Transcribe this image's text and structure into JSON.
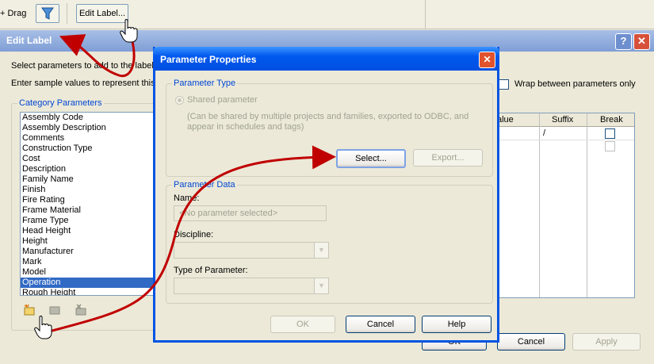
{
  "toolbar": {
    "drag_label": "+ Drag",
    "edit_label_button": "Edit Label..."
  },
  "edit_label": {
    "title": "Edit Label",
    "help_btn": "?",
    "close_btn": "✕",
    "instruction1": "Select parameters to add to the label",
    "instruction2": "Enter sample values to represent this",
    "wrap_label": "Wrap between parameters only",
    "category_params_label": "Category Parameters",
    "params": [
      "Assembly Code",
      "Assembly Description",
      "Comments",
      "Construction Type",
      "Cost",
      "Description",
      "Family Name",
      "Finish",
      "Fire Rating",
      "Frame Material",
      "Frame Type",
      "Head Height",
      "Height",
      "Manufacturer",
      "Mark",
      "Model",
      "Operation",
      "Rough Height"
    ],
    "selected_param": "Operation",
    "table_headers": {
      "value": "alue",
      "suffix": "Suffix",
      "break": "Break"
    },
    "table_row1_suffix": "/",
    "ok_btn": "OK",
    "cancel_btn": "Cancel",
    "apply_btn": "Apply"
  },
  "param_props": {
    "title": "Parameter Properties",
    "close_btn": "✕",
    "param_type_label": "Parameter Type",
    "shared_param": "Shared parameter",
    "shared_desc1": "(Can be shared by multiple projects and families, exported to ODBC, and",
    "shared_desc2": "appear in schedules and tags)",
    "select_btn": "Select...",
    "export_btn": "Export...",
    "param_data_label": "Parameter Data",
    "name_label": "Name:",
    "name_placeholder": "<No parameter selected>",
    "discipline_label": "Discipline:",
    "type_label": "Type of Parameter:",
    "ok_btn": "OK",
    "cancel_btn": "Cancel",
    "help_btn": "Help"
  },
  "colors": {
    "arrow": "#c00000",
    "xp_blue": "#0054e3",
    "selection": "#316ac5"
  }
}
